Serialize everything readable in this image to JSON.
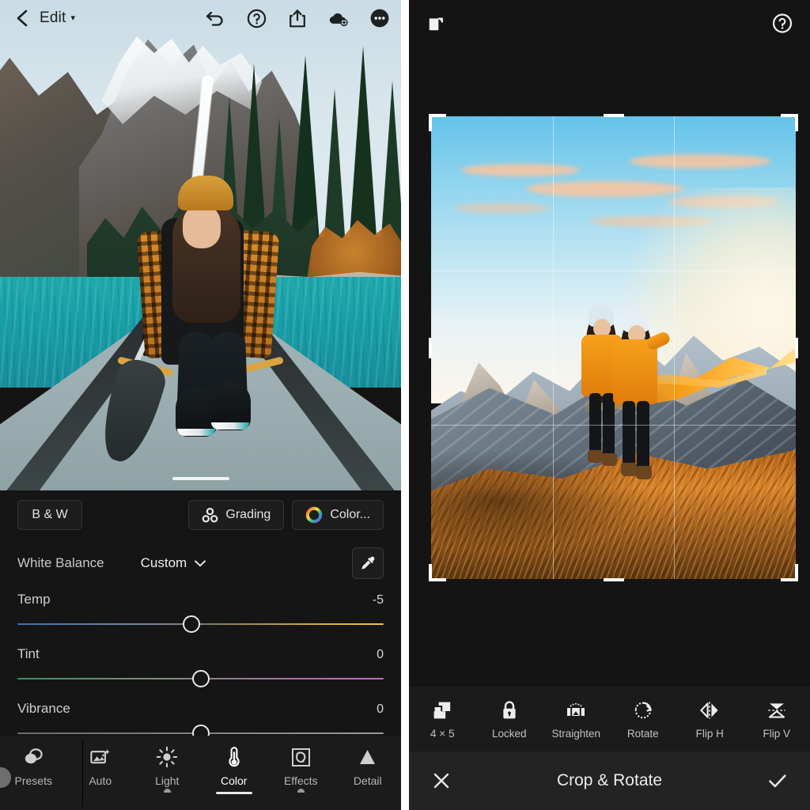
{
  "left_app": {
    "topbar": {
      "back_icon": "chevron-left-icon",
      "title": "Edit",
      "title_caret": "▾",
      "icons": [
        {
          "name": "undo-icon",
          "label": "Undo"
        },
        {
          "name": "help-circle-icon",
          "label": "Help"
        },
        {
          "name": "share-export-icon",
          "label": "Share"
        },
        {
          "name": "cloud-add-icon",
          "label": "Add to cloud"
        },
        {
          "name": "more-ellipsis-icon",
          "label": "More"
        }
      ]
    },
    "chips": [
      {
        "name": "bw-button",
        "label": "B & W",
        "icon": null
      },
      {
        "name": "grading-button",
        "label": "Grading",
        "icon": "color-grading-icon"
      },
      {
        "name": "color-mix-button",
        "label": "Color...",
        "icon": "color-wheel-icon"
      }
    ],
    "white_balance": {
      "label": "White Balance",
      "value": "Custom",
      "caret": "⌄",
      "eyedropper_icon": "eyedropper-icon"
    },
    "sliders": [
      {
        "name": "temp-slider",
        "label": "Temp",
        "value": "-5",
        "position_pct": 47.5,
        "track": "temp"
      },
      {
        "name": "tint-slider",
        "label": "Tint",
        "value": "0",
        "position_pct": 50,
        "track": "tint"
      },
      {
        "name": "vibrance-slider",
        "label": "Vibrance",
        "value": "0",
        "position_pct": 50,
        "track": "vib"
      }
    ],
    "tabs": [
      {
        "name": "tab-presets",
        "label": "Presets",
        "icon": "presets-overlap-circles-icon",
        "active": false,
        "marker": "none"
      },
      {
        "name": "tab-auto",
        "label": "Auto",
        "icon": "auto-magic-photo-icon",
        "active": false,
        "marker": "none"
      },
      {
        "name": "tab-light",
        "label": "Light",
        "icon": "sun-icon",
        "active": false,
        "marker": "dot"
      },
      {
        "name": "tab-color",
        "label": "Color",
        "icon": "thermometer-icon",
        "active": true,
        "marker": "underline"
      },
      {
        "name": "tab-effects",
        "label": "Effects",
        "icon": "effects-square-brackets-icon",
        "active": false,
        "marker": "dot"
      },
      {
        "name": "tab-detail",
        "label": "Detail",
        "icon": "triangle-detail-icon",
        "active": false,
        "marker": "none"
      }
    ]
  },
  "right_app": {
    "topbar": {
      "left_icon": "rotate-page-icon",
      "right_icon": "help-circle-icon"
    },
    "crop": {
      "aspect_ratio_label": "4 × 5",
      "grid_lines": 2,
      "handles": "corner-and-edge-handles"
    },
    "tools": [
      {
        "name": "aspect-ratio-tool",
        "label": "4 × 5",
        "icon": "aspect-ratio-stack-icon"
      },
      {
        "name": "lock-aspect-tool",
        "label": "Locked",
        "icon": "lock-closed-icon"
      },
      {
        "name": "straighten-tool",
        "label": "Straighten",
        "icon": "straighten-level-icon"
      },
      {
        "name": "rotate-tool",
        "label": "Rotate",
        "icon": "rotate-cw-icon"
      },
      {
        "name": "flip-h-tool",
        "label": "Flip H",
        "icon": "flip-horizontal-icon"
      },
      {
        "name": "flip-v-tool",
        "label": "Flip V",
        "icon": "flip-vertical-icon"
      }
    ],
    "bottombar": {
      "cancel_icon": "close-x-icon",
      "title": "Crop & Rotate",
      "confirm_icon": "checkmark-icon"
    }
  },
  "colors": {
    "panel_bg": "#141414",
    "controls_bg": "#151515",
    "tabbar_bg": "#1b1b1b",
    "bottombar_bg": "#232323",
    "accent_white": "#ffffff",
    "chip_border": "#343434",
    "text_primary": "#ececec",
    "text_secondary": "#b7b7b7",
    "divider": "#ffffff"
  }
}
